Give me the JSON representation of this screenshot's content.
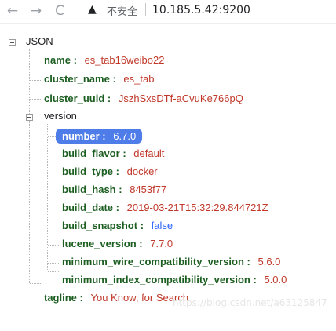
{
  "browser": {
    "back_icon": "←",
    "forward_icon": "→",
    "reload_icon": "C",
    "warning_icon": "▲",
    "security_label": "不安全",
    "url": "10.185.5.42:9200"
  },
  "tree": {
    "root_label": "JSON",
    "name": {
      "key": "name",
      "value": "es_tab16weibo22"
    },
    "cluster_name": {
      "key": "cluster_name",
      "value": "es_tab"
    },
    "cluster_uuid": {
      "key": "cluster_uuid",
      "value": "JszhSxsDTf-aCvuKe766pQ"
    },
    "version": {
      "label": "version",
      "number": {
        "key": "number",
        "value": "6.7.0"
      },
      "build_flavor": {
        "key": "build_flavor",
        "value": "default"
      },
      "build_type": {
        "key": "build_type",
        "value": "docker"
      },
      "build_hash": {
        "key": "build_hash",
        "value": "8453f77"
      },
      "build_date": {
        "key": "build_date",
        "value": "2019-03-21T15:32:29.844721Z"
      },
      "build_snapshot": {
        "key": "build_snapshot",
        "value": "false"
      },
      "lucene_version": {
        "key": "lucene_version",
        "value": "7.7.0"
      },
      "minimum_wire_compatibility_version": {
        "key": "minimum_wire_compatibility_version",
        "value": "5.6.0"
      },
      "minimum_index_compatibility_version": {
        "key": "minimum_index_compatibility_version",
        "value": "5.0.0"
      }
    },
    "tagline": {
      "key": "tagline",
      "value": "You Know, for Search"
    },
    "colon": ":"
  },
  "watermark": "https://blog.csdn.net/a63125847"
}
